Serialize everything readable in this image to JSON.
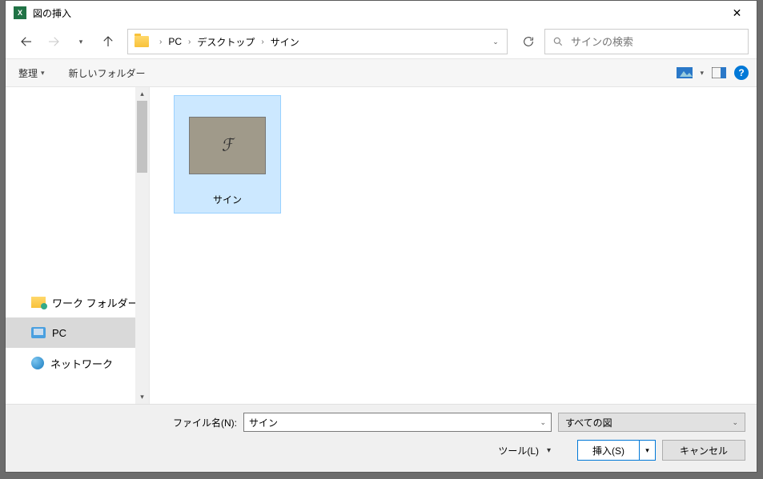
{
  "window": {
    "title": "図の挿入",
    "app_icon_text": "X"
  },
  "breadcrumbs": {
    "items": [
      "PC",
      "デスクトップ",
      "サイン"
    ]
  },
  "search": {
    "placeholder": "サインの検索"
  },
  "toolbar": {
    "organize": "整理",
    "new_folder": "新しいフォルダー"
  },
  "sidebar": {
    "items": [
      {
        "label": "ワーク フォルダー"
      },
      {
        "label": "PC"
      },
      {
        "label": "ネットワーク"
      }
    ],
    "selected_index": 1
  },
  "files": {
    "items": [
      {
        "label": "サイン",
        "selected": true
      }
    ]
  },
  "footer": {
    "filename_label": "ファイル名(N):",
    "filename_value": "サイン",
    "filter_label": "すべての図",
    "tool_label": "ツール(L)",
    "insert_label": "挿入(S)",
    "cancel_label": "キャンセル"
  }
}
